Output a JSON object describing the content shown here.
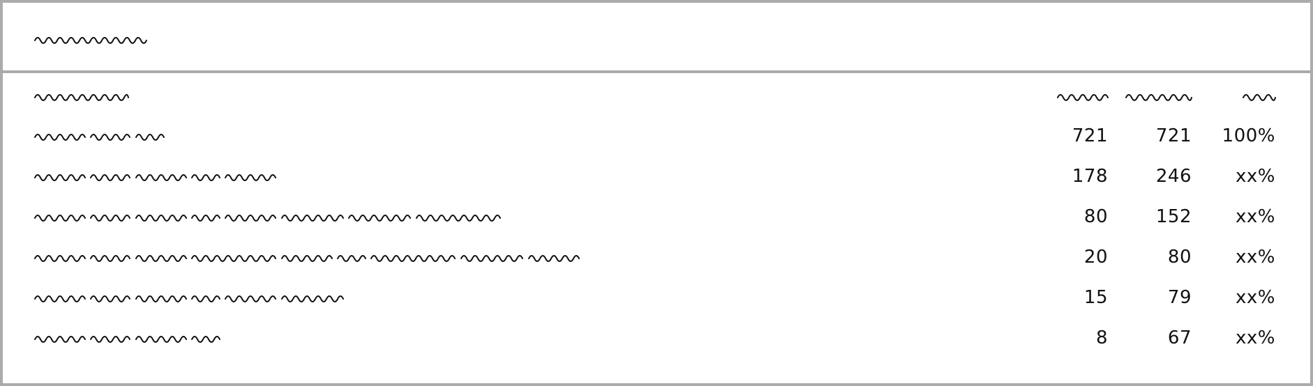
{
  "header": {
    "title_squiggle_words": 1
  },
  "table": {
    "column_headers": [
      "",
      "",
      "",
      ""
    ],
    "rows": [
      {
        "label_words": [
          4,
          3,
          2
        ],
        "col1": "721",
        "col2": "721",
        "col3": "100%"
      },
      {
        "label_words": [
          4,
          3,
          4,
          2,
          4
        ],
        "col1": "178",
        "col2": "246",
        "col3": "xx%"
      },
      {
        "label_words": [
          4,
          3,
          4,
          2,
          4,
          5,
          5,
          7
        ],
        "col1": "80",
        "col2": "152",
        "col3": "xx%"
      },
      {
        "label_words": [
          4,
          3,
          4,
          7,
          4,
          2,
          7,
          5,
          4
        ],
        "col1": "20",
        "col2": "80",
        "col3": "xx%"
      },
      {
        "label_words": [
          4,
          3,
          4,
          2,
          4,
          5
        ],
        "col1": "15",
        "col2": "79",
        "col3": "xx%"
      },
      {
        "label_words": [
          4,
          3,
          4,
          2
        ],
        "col1": "8",
        "col2": "67",
        "col3": "xx%"
      }
    ]
  }
}
